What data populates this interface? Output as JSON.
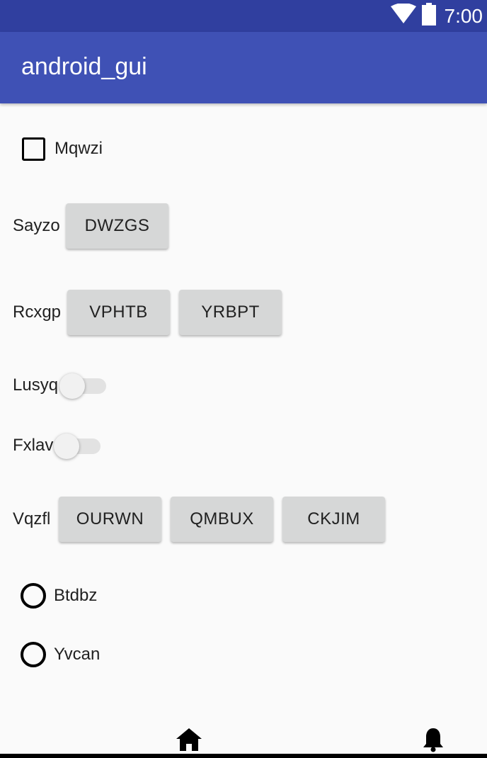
{
  "status_bar": {
    "time": "7:00",
    "icons": [
      "wifi-icon",
      "battery-icon"
    ]
  },
  "app_bar": {
    "title": "android_gui"
  },
  "checkbox": {
    "label": "Mqwzi",
    "checked": false
  },
  "row_sayzo": {
    "label": "Sayzo",
    "buttons": [
      "DWZGS"
    ]
  },
  "row_rcxgp": {
    "label": "Rcxgp",
    "buttons": [
      "VPHTB",
      "YRBPT"
    ]
  },
  "switch_lusyq": {
    "label": "Lusyq",
    "on": false
  },
  "switch_fxlav": {
    "label": "Fxlav",
    "on": false
  },
  "row_vqzfl": {
    "label": "Vqzfl",
    "buttons": [
      "OURWN",
      "QMBUX",
      "CKJIM"
    ]
  },
  "radios": [
    {
      "label": "Btdbz",
      "selected": false
    },
    {
      "label": "Yvcan",
      "selected": false
    }
  ],
  "bottom_nav": {
    "icons": [
      "home-icon",
      "bell-icon"
    ]
  },
  "colors": {
    "status_bar": "#303f9f",
    "app_bar": "#3f51b5",
    "background": "#fafafa",
    "button": "#d6d7d7"
  }
}
